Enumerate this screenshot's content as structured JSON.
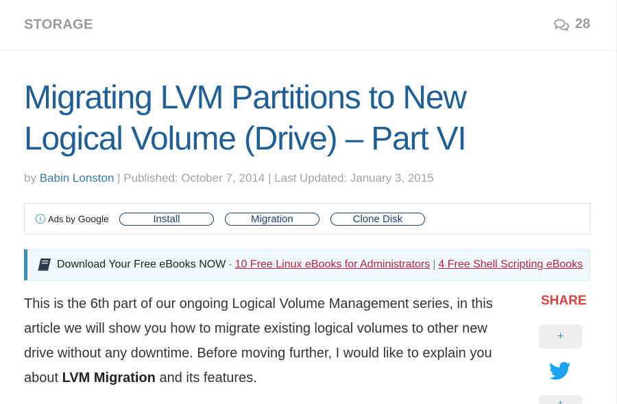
{
  "header": {
    "category": "STORAGE",
    "comment_count": "28"
  },
  "article": {
    "title": "Migrating LVM Partitions to New Logical Volume (Drive) – Part VI",
    "meta": {
      "by": "by",
      "author": "Babin Lonston",
      "published": "| Published: October 7, 2014 | Last Updated: January 3, 2015"
    },
    "intro_before": "This is the 6th part of our ongoing Logical Volume Management series, in this article we will show you how to migrate existing logical volumes to other new drive without any downtime. Before moving further, I would like to explain you about ",
    "intro_bold": "LVM Migration",
    "intro_after": " and its features."
  },
  "ads": {
    "label": "Ads by",
    "brand": "Google",
    "info_glyph": "i",
    "pills": [
      "Install",
      "Migration",
      "Clone Disk"
    ]
  },
  "ebooks": {
    "icon": "book-icon",
    "text": "Download Your Free eBooks NOW",
    "dash": "-",
    "link1": "10 Free Linux eBooks for Administrators",
    "sep": "|",
    "link2": "4 Free Shell Scripting eBooks"
  },
  "share": {
    "label": "SHARE",
    "plus": "+",
    "next": "+"
  },
  "colors": {
    "title": "#1f5f95",
    "author_link": "#3a78b0",
    "ebook_link": "#b8273c",
    "share": "#d9423d",
    "twitter": "#1da1f2"
  }
}
